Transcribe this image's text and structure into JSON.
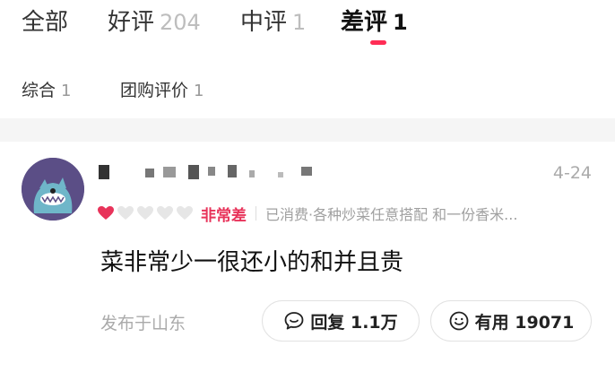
{
  "tabs": [
    {
      "label": "全部",
      "count": "",
      "active": false
    },
    {
      "label": "好评",
      "count": "204",
      "active": false
    },
    {
      "label": "中评",
      "count": "1",
      "active": false
    },
    {
      "label": "差评",
      "count": "1",
      "active": true
    }
  ],
  "filters": [
    {
      "label": "综合",
      "count": "1"
    },
    {
      "label": "团购评价",
      "count": "1"
    }
  ],
  "review": {
    "date": "4-24",
    "rating_hearts_filled": 1,
    "rating_hearts_total": 5,
    "rating_text": "非常差",
    "purchase_info": "已消费·各种炒菜任意搭配 和一份香米...",
    "content": "菜非常少一很还小的和并且贵",
    "location": "发布于山东",
    "reply_label": "回复 1.1万",
    "useful_label": "有用 19071"
  },
  "colors": {
    "accent": "#ff2d55",
    "rating_red": "#e8335a"
  }
}
